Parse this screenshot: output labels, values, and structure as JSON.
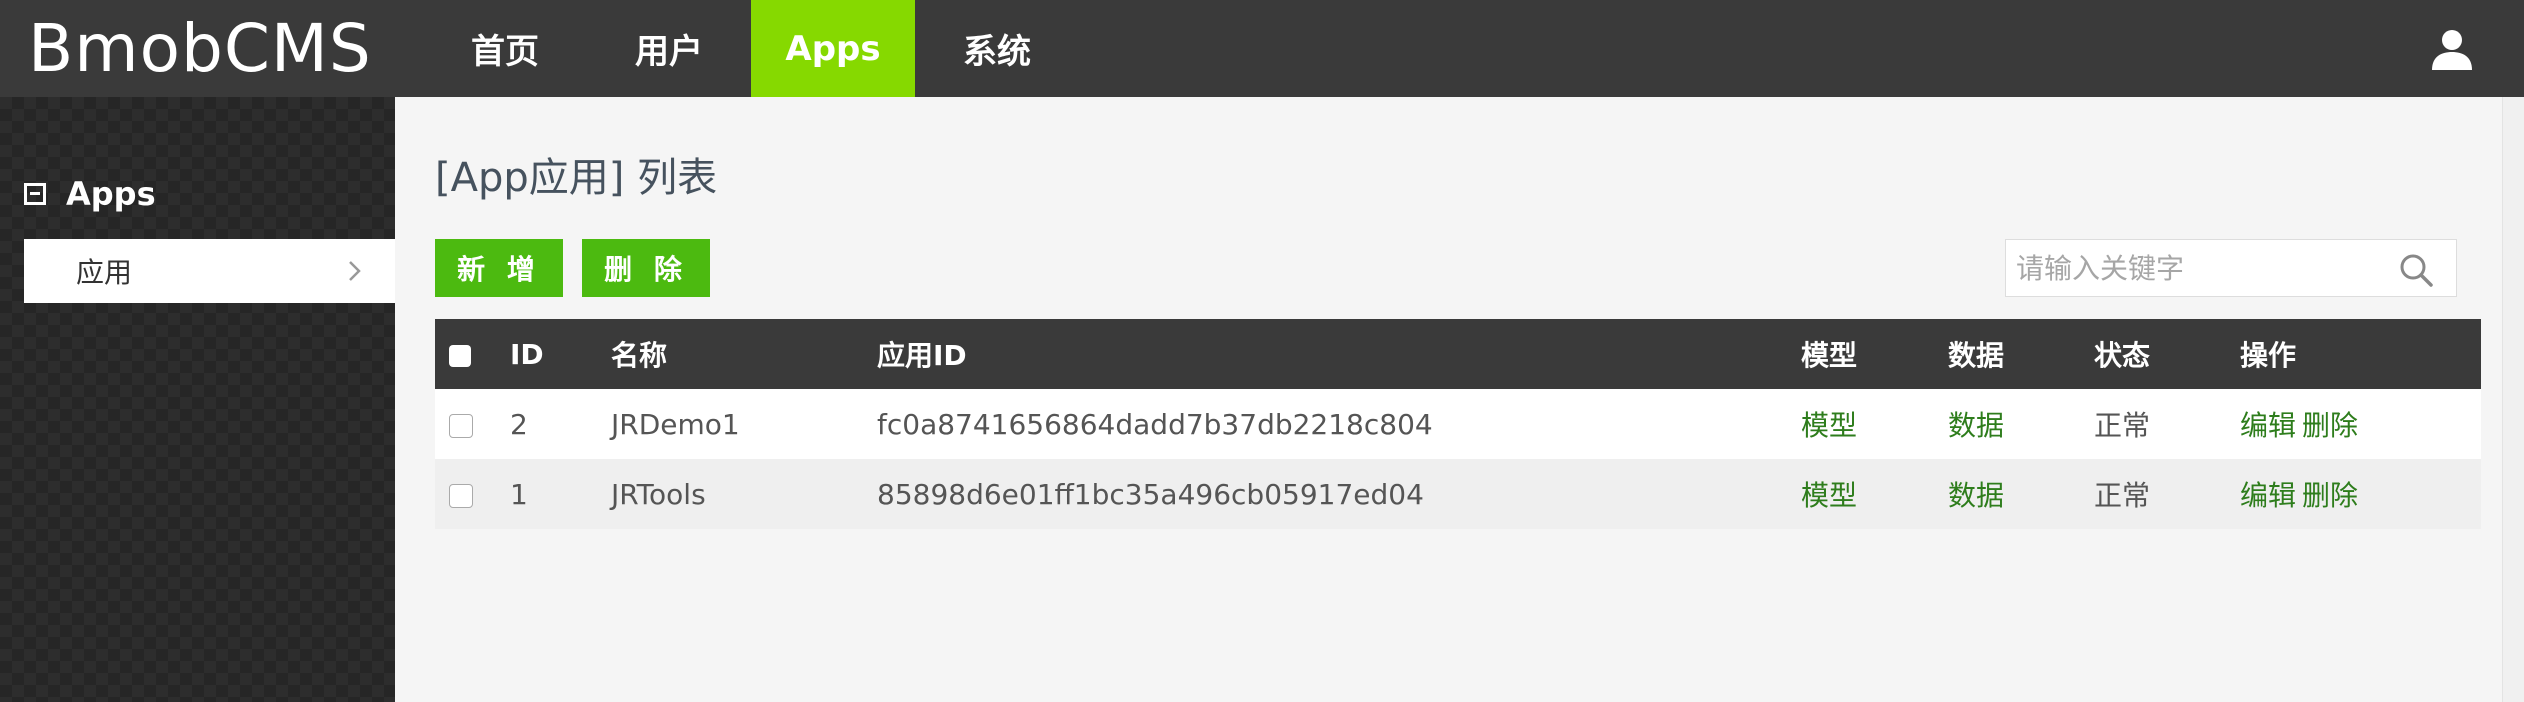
{
  "app": {
    "brand": "BmobCMS"
  },
  "nav": {
    "items": [
      {
        "label": "首页",
        "active": false
      },
      {
        "label": "用户",
        "active": false
      },
      {
        "label": "Apps",
        "active": true
      },
      {
        "label": "系统",
        "active": false
      }
    ]
  },
  "sidebar": {
    "group_label": "Apps",
    "items": [
      {
        "label": "应用",
        "selected": true
      }
    ]
  },
  "main": {
    "title": "[App应用] 列表",
    "add_label": "新 增",
    "delete_label": "删 除",
    "search_placeholder": "请输入关键字"
  },
  "table": {
    "headers": [
      "ID",
      "名称",
      "应用ID",
      "模型",
      "数据",
      "状态",
      "操作"
    ],
    "rows": [
      {
        "id": "2",
        "name": "JRDemo1",
        "app_id": "fc0a8741656864dadd7b37db2218c804",
        "model": "模型",
        "data": "数据",
        "status": "正常",
        "edit": "编辑",
        "delete": "删除"
      },
      {
        "id": "1",
        "name": "JRTools",
        "app_id": "85898d6e01ff1bc35a496cb05917ed04",
        "model": "模型",
        "data": "数据",
        "status": "正常",
        "edit": "编辑",
        "delete": "删除"
      }
    ]
  },
  "icons": {
    "user": "user-icon",
    "search": "search-icon",
    "chevron": "chevron-right-icon",
    "collapse": "collapse-icon"
  },
  "colors": {
    "topbar": "#3a3a3a",
    "nav_active": "#86d900",
    "button": "#4cba10",
    "link": "#2e7d1c",
    "title": "#46525e"
  }
}
